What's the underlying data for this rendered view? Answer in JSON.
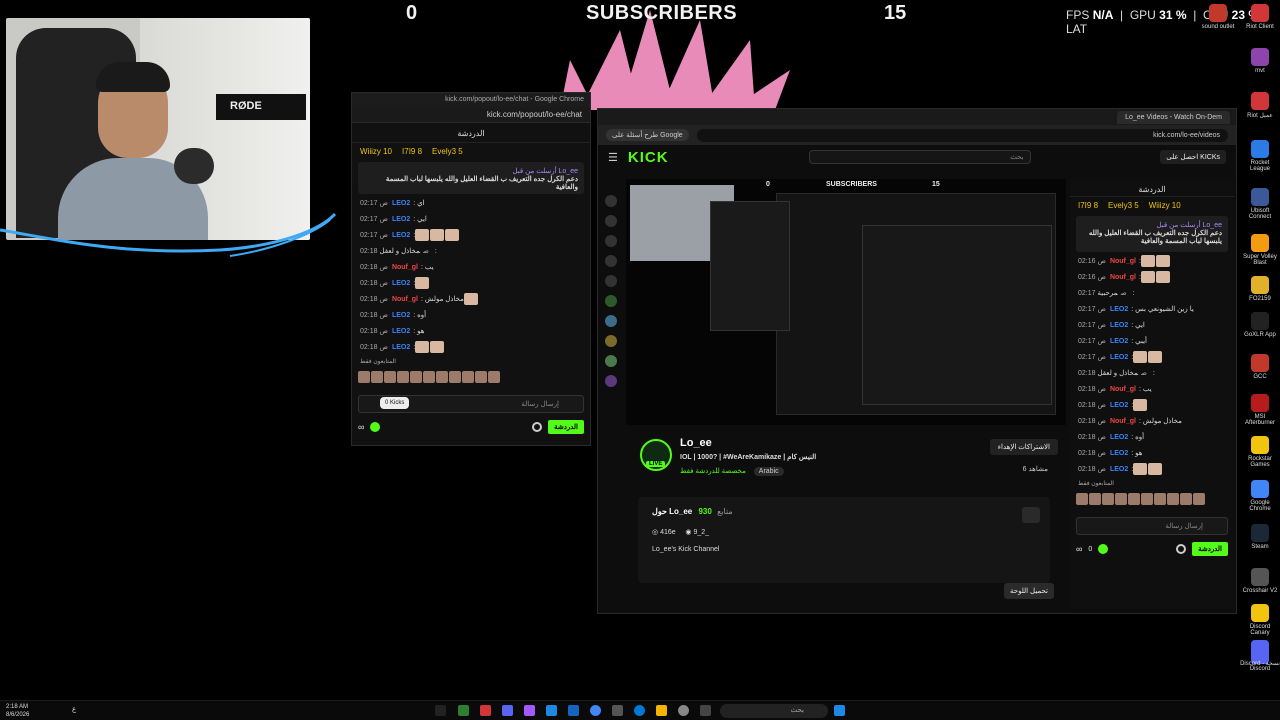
{
  "overlay": {
    "left_num": "0",
    "title": "SUBSCRIBERS",
    "right_num": "15",
    "stats": {
      "fps_label": "FPS",
      "fps": "N/A",
      "gpu_label": "GPU",
      "gpu": "31 %",
      "cpu_label": "CPU",
      "cpu": "23 %",
      "lat": "LAT"
    },
    "rode": "RØDE"
  },
  "popout": {
    "titlebar": "kick.com/popout/lo-ee/chat - Google Chrome",
    "address": "kick.com/popout/lo-ee/chat",
    "chat_title": "الدردشة",
    "gifters": [
      "Wiiizy 10",
      "I7I9 8",
      "Evely3 5"
    ],
    "pinned_by": "أرسلت من قبل Lo_ee",
    "pinned_text": "دعم الكرل جده التعريف ب القضاء العليل والله يلبسها لباب المسمة والعافية",
    "messages": [
      {
        "time": "02:17 ص",
        "user": "LEO2",
        "text": ": اي"
      },
      {
        "time": "02:17 ص",
        "user": "LEO2",
        "text": ": ايي"
      },
      {
        "time": "02:17 ص",
        "user": "LEO2",
        "text": ":"
      },
      {
        "time": "02:18 ص",
        "user": "",
        "text": "مخاذل و لعقل :"
      },
      {
        "time": "02:18 ص",
        "user": "Nouf_gl",
        "text": ": يب"
      },
      {
        "time": "02:18 ص",
        "user": "LEO2",
        "text": ":"
      },
      {
        "time": "02:18 ص",
        "user": "Nouf_gl",
        "text": ": مخاذل مولش"
      },
      {
        "time": "02:18 ص",
        "user": "LEO2",
        "text": ": أوه"
      },
      {
        "time": "02:18 ص",
        "user": "LEO2",
        "text": ": هو"
      },
      {
        "time": "02:18 ص",
        "user": "LEO2",
        "text": ":"
      }
    ],
    "emote_label": "المتابعون فقط",
    "input_placeholder": "إرسال رسالة",
    "kicks_tip": "0 Kicks",
    "chat_button": "الدردشة"
  },
  "browser": {
    "tab_title": "Lo_ee Videos - Watch On-Dem",
    "address": "kick.com/lo-ee/videos",
    "google_q": "طرح أسئلة على Google",
    "logo": "KICK",
    "search_placeholder": "بحث",
    "get_kicks": "احصل على KICKs",
    "player_left": "0",
    "player_title": "SUBSCRIBERS",
    "player_right": "15",
    "streamer": {
      "name": "Lo_ee",
      "title": "IOL | 1000? | #WeAreKamikaze | النيس كام",
      "category": "مخصصة للدردشة فقط",
      "tag": "Arabic",
      "subs_btn": "الاشتراكات الإهداء",
      "viewers": "6 مشاهد"
    },
    "about": {
      "heading": "حول Lo_ee",
      "followers": "930",
      "followers_label": "متابع",
      "instagram": "416e",
      "discord": "9_2_",
      "bio": "Lo_ee's Kick Channel"
    },
    "edit_panel": "تحميل اللوحة",
    "right_chat": {
      "title": "الدردشة",
      "gifters": [
        "I7I9 8",
        "Evely3 5",
        "Wiiizy 10"
      ],
      "pinned_by": "أرسلت من قبل Lo_ee",
      "pinned_text": "دعم الكرل جده التعريف ب القضاء العليل والله يلبسها لباب المسمة والعافية",
      "messages": [
        {
          "time": "02:16 ص",
          "user": "Nouf_gl",
          "text": ":"
        },
        {
          "time": "02:16 ص",
          "user": "Nouf_gl",
          "text": ":"
        },
        {
          "time": "02:17 ص",
          "user": "",
          "text": "مرحبية :"
        },
        {
          "time": "02:17 ص",
          "user": "LEO2",
          "text": ": يا زين الشيونعي بس"
        },
        {
          "time": "02:17 ص",
          "user": "LEO2",
          "text": ": ايي"
        },
        {
          "time": "02:17 ص",
          "user": "LEO2",
          "text": ": أيبي"
        },
        {
          "time": "02:17 ص",
          "user": "LEO2",
          "text": ":"
        },
        {
          "time": "02:18 ص",
          "user": "",
          "text": "مخاذل و لعقل :"
        },
        {
          "time": "02:18 ص",
          "user": "Nouf_gl",
          "text": ": يب"
        },
        {
          "time": "02:18 ص",
          "user": "LEO2",
          "text": ":"
        },
        {
          "time": "02:18 ص",
          "user": "Nouf_gl",
          "text": ": مخاذل مولش"
        },
        {
          "time": "02:18 ص",
          "user": "LEO2",
          "text": ": أوه"
        },
        {
          "time": "02:18 ص",
          "user": "LEO2",
          "text": ": هو"
        },
        {
          "time": "02:18 ص",
          "user": "LEO2",
          "text": ":"
        }
      ],
      "emote_label": "المتابعون فقط",
      "input_placeholder": "إرسال رسالة",
      "kicks": "0",
      "chat_button": "الدردشة"
    }
  },
  "desktop_icons": [
    {
      "label": "sound outlet",
      "color": "#c0392b"
    },
    {
      "label": "Riot Client",
      "color": "#d13639"
    },
    {
      "label": "mvt",
      "color": "#8e44ad"
    },
    {
      "label": "Riot عميل",
      "color": "#d13639"
    },
    {
      "label": "Rocket League",
      "color": "#2c7be5"
    },
    {
      "label": "Ubisoft Connect",
      "color": "#3b5998"
    },
    {
      "label": "Super Volley Blast",
      "color": "#f39c12"
    },
    {
      "label": "FO2159",
      "color": "#e1b12c"
    },
    {
      "label": "GoXLR App",
      "color": "#222222"
    },
    {
      "label": "GCC",
      "color": "#c0392b"
    },
    {
      "label": "MSI Afterburner",
      "color": "#b71c1c"
    },
    {
      "label": "Rockstar Games",
      "color": "#f1c40f"
    },
    {
      "label": "Google Chrome",
      "color": "#4285f4"
    },
    {
      "label": "Steam",
      "color": "#1b2838"
    },
    {
      "label": "Crosshair V2",
      "color": "#555555"
    },
    {
      "label": "Discord Canary",
      "color": "#f1c40f"
    },
    {
      "label": "Discord",
      "color": "#5865f2"
    },
    {
      "label": "Discord - نسخة",
      "color": "#5865f2"
    }
  ],
  "taskbar": {
    "time": "2:18 AM",
    "date": "8/6/2026",
    "search_placeholder": "بحث",
    "lang": "ع"
  }
}
